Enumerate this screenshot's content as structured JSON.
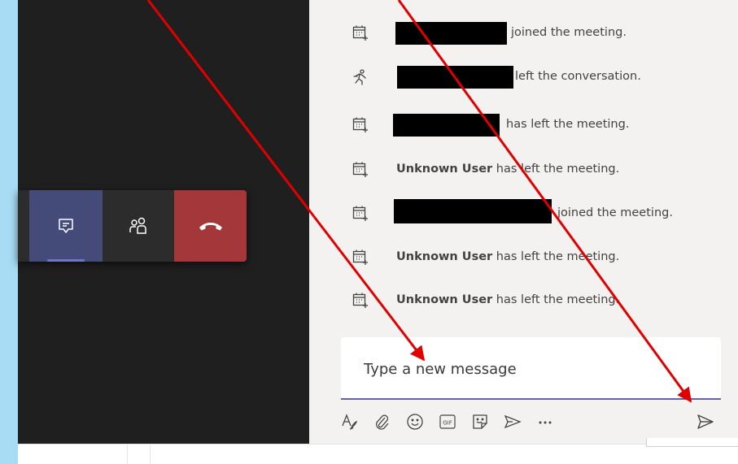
{
  "chat": {
    "messages": [
      {
        "name": "",
        "text": "joined the meeting.",
        "icon": "meeting-join-icon",
        "redacted": true
      },
      {
        "name": "",
        "text": "left the conversation.",
        "icon": "person-leave-icon",
        "redacted": true
      },
      {
        "name": "",
        "text": "has left the meeting.",
        "icon": "meeting-join-icon",
        "redacted": true
      },
      {
        "name": "Unknown User",
        "text": "has left the meeting.",
        "icon": "meeting-join-icon",
        "redacted": false
      },
      {
        "name": "",
        "text": "joined the meeting.",
        "icon": "meeting-join-icon",
        "redacted": true
      },
      {
        "name": "Unknown User",
        "text": "has left the meeting.",
        "icon": "meeting-join-icon",
        "redacted": false
      },
      {
        "name": "Unknown User",
        "text": "has left the meeting.",
        "icon": "meeting-join-icon",
        "redacted": false
      }
    ],
    "compose_placeholder": "Type a new message",
    "toolbar": [
      "format-icon",
      "attach-icon",
      "emoji-icon",
      "gif-icon",
      "sticker-icon",
      "meet-now-icon",
      "more-options-icon",
      "send-icon"
    ]
  },
  "call_controls": [
    "chat-icon",
    "participants-icon",
    "hang-up-icon"
  ],
  "colors": {
    "background": "#a8dcf4",
    "stage": "#1f1f1f",
    "panel": "#f3f2f1",
    "chat_active": "#454b79",
    "hangup": "#a4373a",
    "accent": "#6264a7",
    "annotation": "#e00000"
  }
}
